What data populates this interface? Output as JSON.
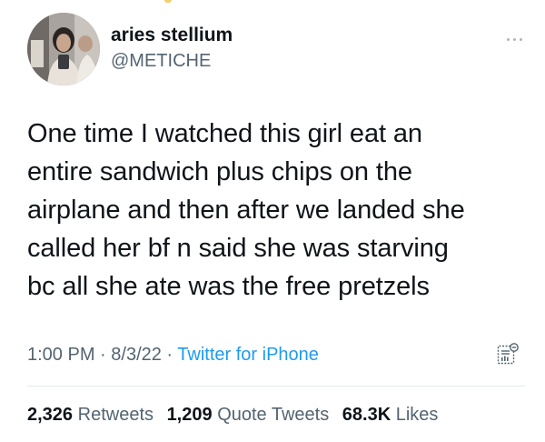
{
  "user": {
    "display_name": "aries stellium",
    "handle": "@METICHE"
  },
  "tweet": {
    "lines": [
      "One time I watched this girl eat an",
      "entire sandwich plus chips on the",
      "airplane and then after we landed she",
      "called her bf n said she was starving",
      "bc all she ate was the free pretzels"
    ]
  },
  "meta": {
    "time": "1:00 PM",
    "separator": " · ",
    "date": "8/3/22",
    "source": "Twitter for iPhone"
  },
  "stats": {
    "retweets_count": "2,326",
    "retweets_label": "Retweets",
    "quote_count": "1,209",
    "quote_label": "Quote Tweets",
    "likes_count": "68.3K",
    "likes_label": "Likes"
  },
  "colors": {
    "text": "#0f1419",
    "secondary": "#536471",
    "link": "#1d9bf0",
    "divider": "#e3e7ea"
  },
  "icons": {
    "more": "more-horizontal-icon",
    "analytics": "analytics-icon"
  }
}
